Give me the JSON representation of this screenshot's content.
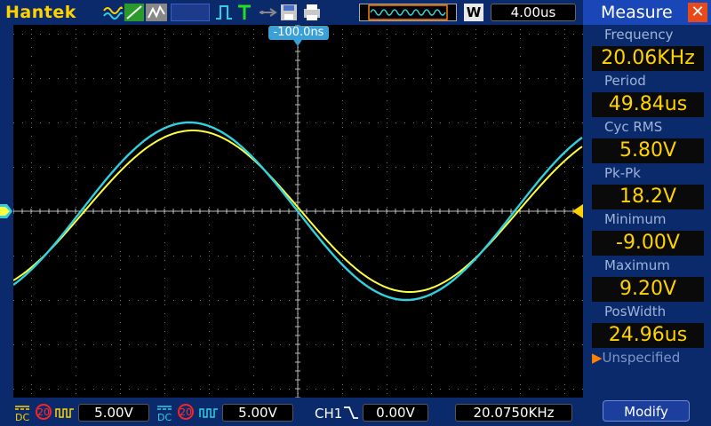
{
  "brand": "Hantek",
  "toolbar": {
    "w_label": "W",
    "timebase": "4.00us"
  },
  "trigger_position": "-100.0ns",
  "measure": {
    "title": "Measure",
    "items": [
      {
        "label": "Frequency",
        "value": "20.06KHz"
      },
      {
        "label": "Period",
        "value": "49.84us"
      },
      {
        "label": "Cyc RMS",
        "value": "5.80V"
      },
      {
        "label": "Pk-Pk",
        "value": "18.2V"
      },
      {
        "label": "Minimum",
        "value": "-9.00V"
      },
      {
        "label": "Maximum",
        "value": "9.20V"
      },
      {
        "label": "PosWidth",
        "value": "24.96us"
      }
    ],
    "unspecified": "Unspecified",
    "modify_label": "Modify"
  },
  "bottom": {
    "ch1_coupling": "DC",
    "ch1_bw": "20",
    "ch1_volts": "5.00V",
    "ch2_coupling": "DC",
    "ch2_bw": "20",
    "ch2_volts": "5.00V",
    "trig_source": "CH1",
    "trig_level": "0.00V",
    "freq_counter": "20.0750KHz"
  },
  "colors": {
    "ch1": "#ffff40",
    "ch2": "#30d0e0",
    "accent": "#ffd200",
    "panel_bg": "#0b2a6b"
  }
}
